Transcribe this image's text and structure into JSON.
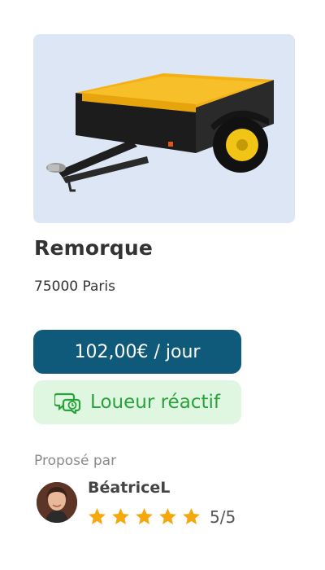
{
  "listing": {
    "title": "Remorque",
    "location": "75000 Paris",
    "price": "102,00€ / jour",
    "badge_label": "Loueur réactif",
    "image_subject": "trailer-illustration"
  },
  "owner": {
    "proposed_label": "Proposé par",
    "name": "BéatriceL",
    "rating_stars": 5,
    "rating_text": "5/5"
  },
  "colors": {
    "price_bg": "#0f5a7a",
    "badge_bg": "#dff6e1",
    "badge_text": "#2aa23c",
    "star": "#f5a80c",
    "image_bg": "#dde6f4"
  },
  "icons": {
    "badge": "chat-clock-icon",
    "star": "star-icon"
  }
}
